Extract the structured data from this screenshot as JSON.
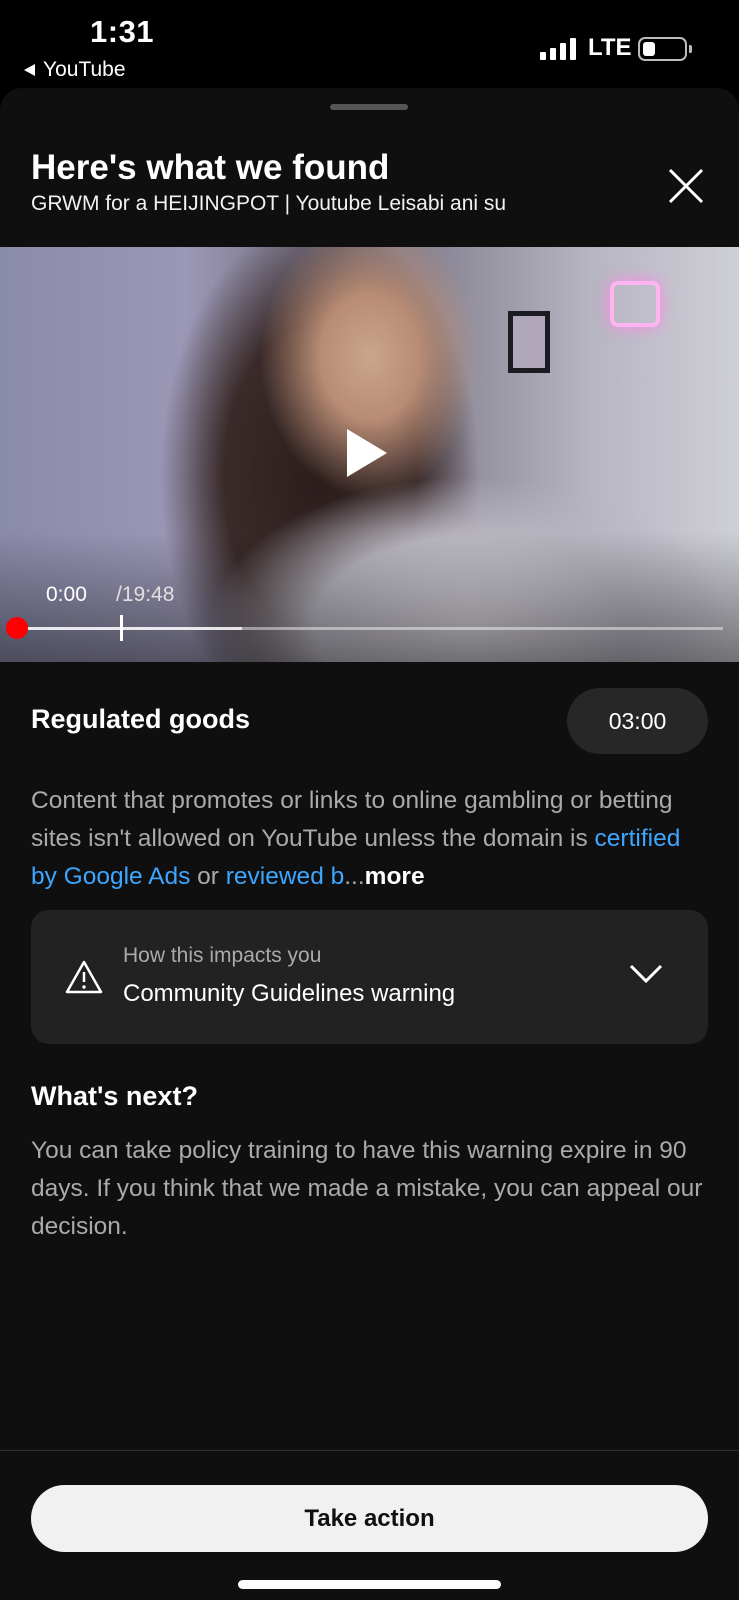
{
  "status_bar": {
    "time": "1:31",
    "back_app": "YouTube",
    "carrier": "LTE",
    "signal_bars": 4,
    "battery_level": 0.3
  },
  "sheet": {
    "title": "Here's what we found",
    "subtitle": "GRWM for a HEIJINGPOT | Youtube Leisabi ani su",
    "close_icon": "close-icon"
  },
  "video": {
    "current_time": "0:00",
    "total_time": "/19:48",
    "play_icon": "play-icon",
    "buffered_fraction": 0.32,
    "played_fraction": 0.0
  },
  "violation": {
    "category": "Regulated goods",
    "timestamp": "03:00",
    "text_part1": "Content that promotes or links to online gambling or betting sites isn't allowed on YouTube unless the domain is ",
    "link1": "certified by Google Ads",
    "text_part2": " or ",
    "link2": "reviewed b",
    "ellipsis": "...",
    "more": "more"
  },
  "impact": {
    "label": "How this impacts you",
    "value": "Community Guidelines warning",
    "icon": "warning-icon",
    "chevron": "chevron-down-icon"
  },
  "next": {
    "title": "What's next?",
    "text": "You can take policy training to have this warning expire in 90 days. If you think that we made a mistake, you can appeal our decision."
  },
  "footer": {
    "action_label": "Take action"
  },
  "colors": {
    "background": "#0f0f0f",
    "link": "#3ea6ff",
    "progress_red": "#ff0000",
    "card": "#222222"
  }
}
